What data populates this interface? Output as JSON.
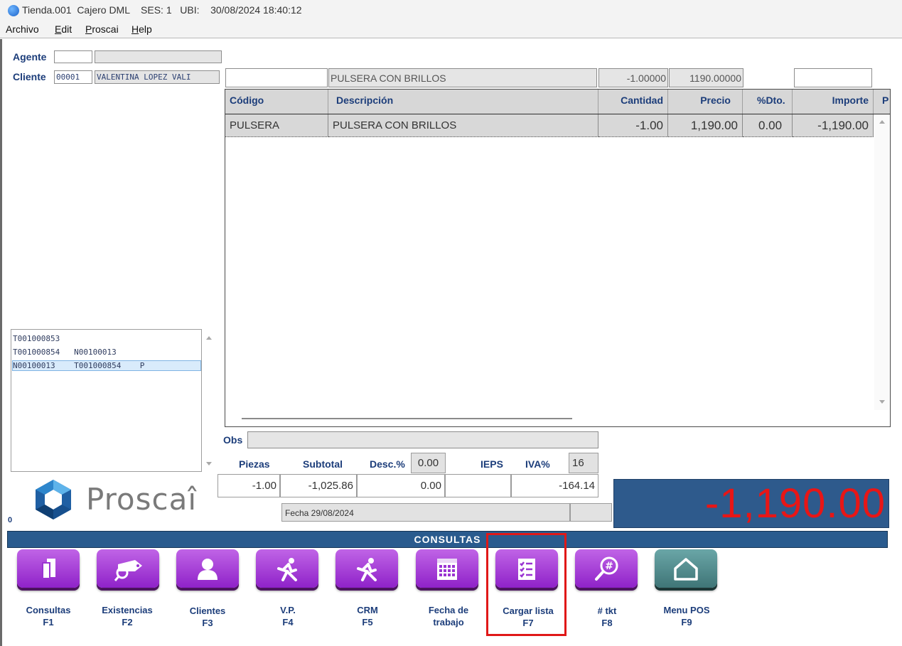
{
  "window": {
    "title": "Tienda.001  Cajero DML    SES: 1   UBI:    30/08/2024 18:40:12"
  },
  "menu": [
    "Archivo",
    "Edit",
    "Proscai",
    "Help"
  ],
  "header": {
    "agente_label": "Agente",
    "agente_code": "",
    "agente_name": "",
    "cliente_label": "Cliente",
    "cliente_code": "00001",
    "cliente_name": "VALENTINA LOPEZ VALI"
  },
  "entry": {
    "code": "",
    "description": "PULSERA CON BRILLOS",
    "quantity": "-1.00000",
    "price": "1190.00000",
    "extra": ""
  },
  "grid": {
    "columns": [
      "Código",
      "Descripción",
      "Cantidad",
      "Precio",
      "%Dto.",
      "Importe",
      "P"
    ],
    "rows": [
      {
        "codigo": "PULSERA",
        "descripcion": "PULSERA CON BRILLOS",
        "cantidad": "-1.00",
        "precio": "1,190.00",
        "dto": "0.00",
        "importe": "-1,190.00"
      }
    ]
  },
  "doc_list": [
    "T001000853",
    "T001000854   N00100013",
    "N00100013    T001000854    P"
  ],
  "obs_label": "Obs",
  "totals": {
    "piezas_label": "Piezas",
    "subtotal_label": "Subtotal",
    "desc_label": "Desc.%",
    "desc_value": "0.00",
    "ieps_label": "IEPS",
    "iva_label": "IVA%",
    "iva_value": "16",
    "piezas": "-1.00",
    "subtotal": "-1,025.86",
    "descuento": "0.00",
    "ieps": "",
    "iva": "-164.14",
    "fecha": "Fecha 29/08/2024",
    "grand_total": "-1,190.00"
  },
  "brand": {
    "logo_text": "Proscaî",
    "counter": "0"
  },
  "consultas_title": "CONSULTAS",
  "buttons": [
    {
      "label": "Consultas",
      "key": "F1"
    },
    {
      "label": "Existencias",
      "key": "F2"
    },
    {
      "label": "Clientes",
      "key": "F3"
    },
    {
      "label": "V.P.",
      "key": "F4"
    },
    {
      "label": "CRM",
      "key": "F5"
    },
    {
      "label": "Fecha de",
      "key": "trabajo"
    },
    {
      "label": "Cargar lista",
      "key": "F7"
    },
    {
      "label": "# tkt",
      "key": "F8"
    },
    {
      "label": "Menu POS",
      "key": "F9"
    }
  ],
  "colors": {
    "accent_blue": "#2a5b8e",
    "tile_purple": "#a63fd8",
    "tile_teal": "#4f8788",
    "total_red": "#e81616"
  }
}
